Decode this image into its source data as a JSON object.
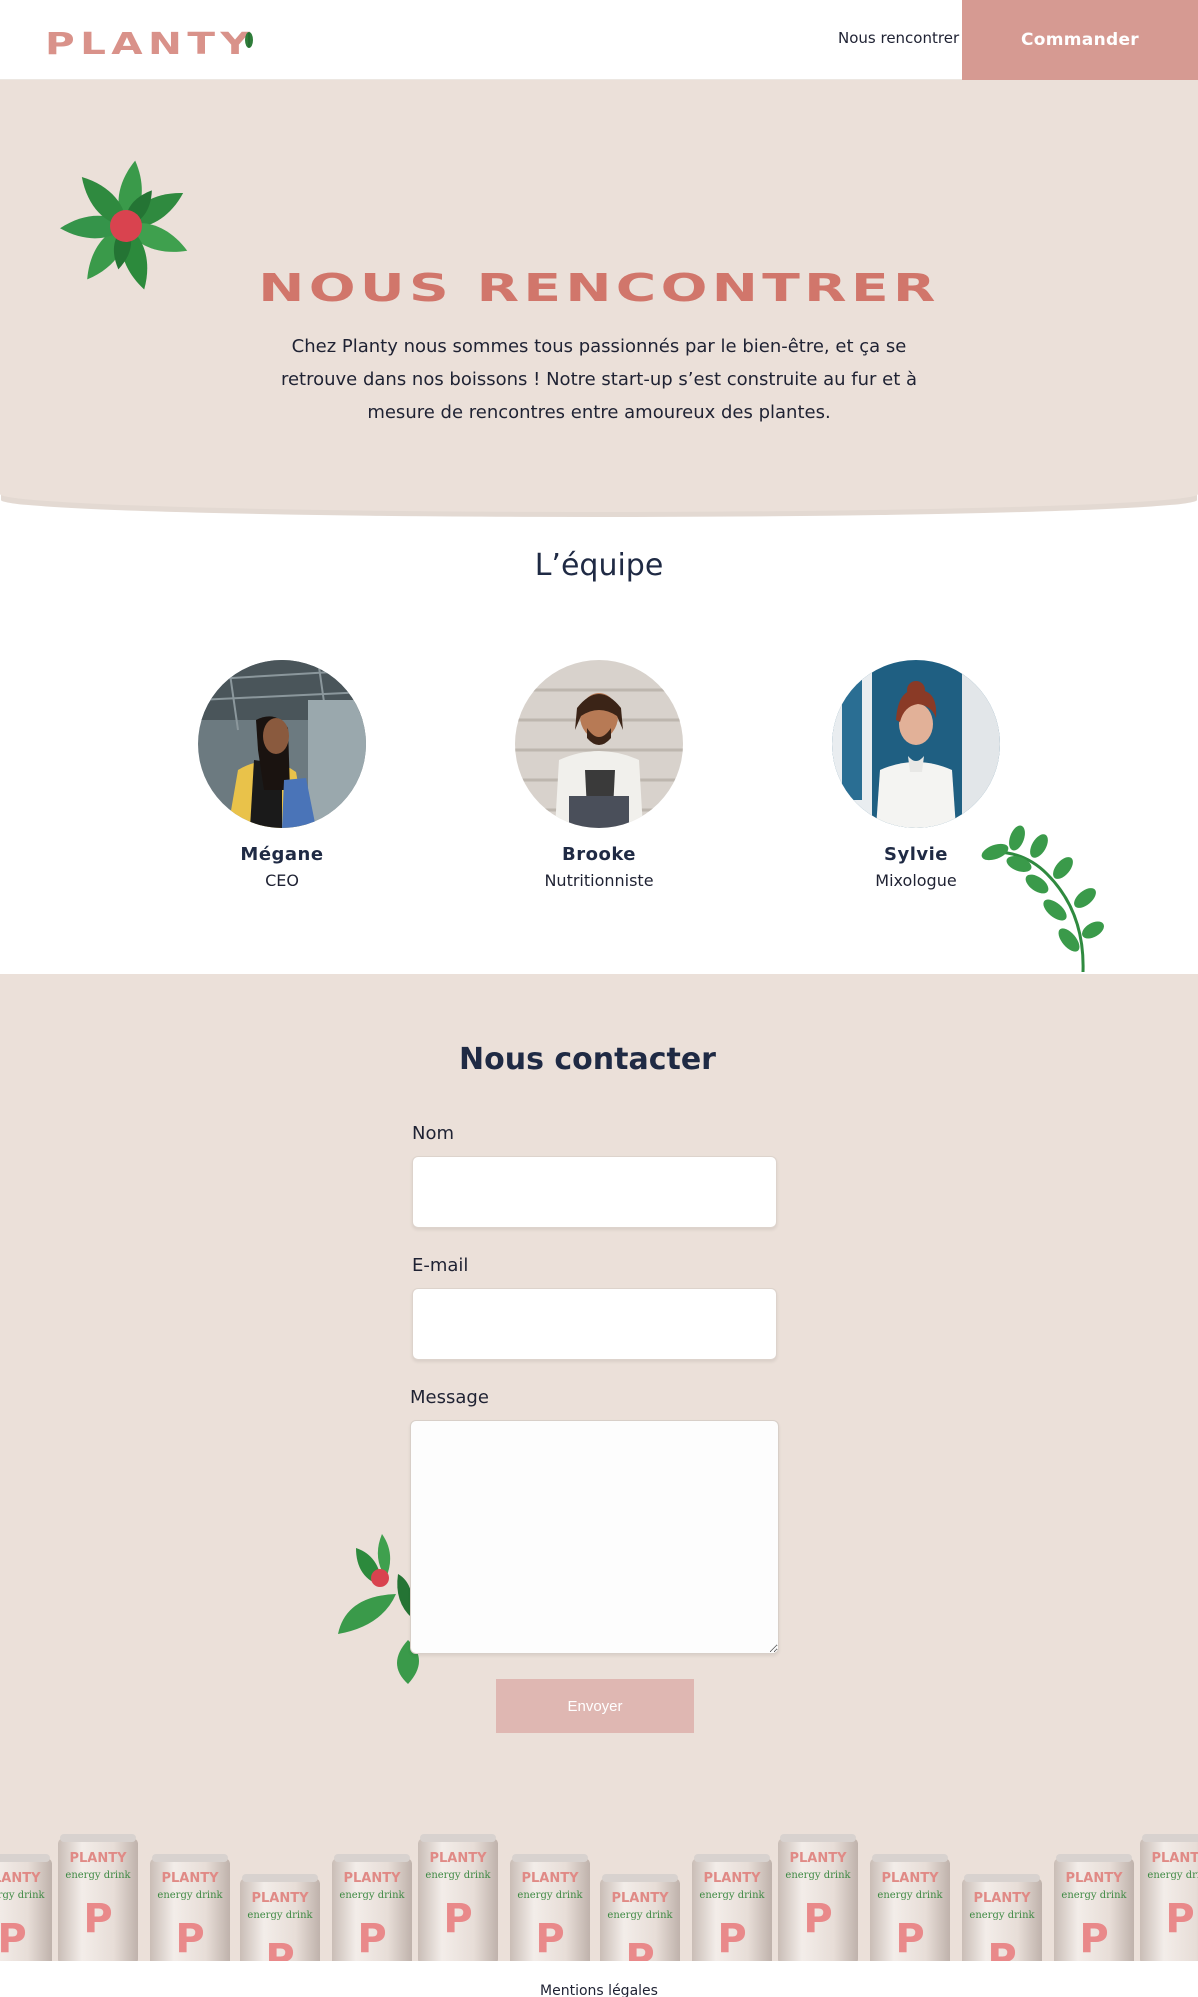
{
  "header": {
    "logo_text": "PLANTY",
    "nav_link": "Nous rencontrer",
    "order_button": "Commander"
  },
  "hero": {
    "title": "NOUS RENCONTRER",
    "text": "Chez Planty nous sommes tous passionnés par le bien-être, et ça se retrouve dans nos boissons ! Notre start-up s’est construite au fur et à mesure de rencontres entre amoureux des plantes."
  },
  "team": {
    "title": "L’équipe",
    "members": [
      {
        "name": "Mégane",
        "role": "CEO"
      },
      {
        "name": "Brooke",
        "role": "Nutritionniste"
      },
      {
        "name": "Sylvie",
        "role": "Mixologue"
      }
    ]
  },
  "contact": {
    "title": "Nous contacter",
    "name_label": "Nom",
    "email_label": "E-mail",
    "message_label": "Message",
    "name_value": "",
    "email_value": "",
    "message_value": "",
    "submit_label": "Envoyer"
  },
  "can": {
    "brand": "PLANTY",
    "subtitle": "energy drink",
    "letter": "P"
  },
  "footer": {
    "legal_link": "Mentions légales"
  },
  "colors": {
    "brand_pink": "#d69a92",
    "hero_title": "#d1766b",
    "beige": "#ebe0d9",
    "leaf_green": "#3a9a4a",
    "navy": "#1f2a44"
  }
}
